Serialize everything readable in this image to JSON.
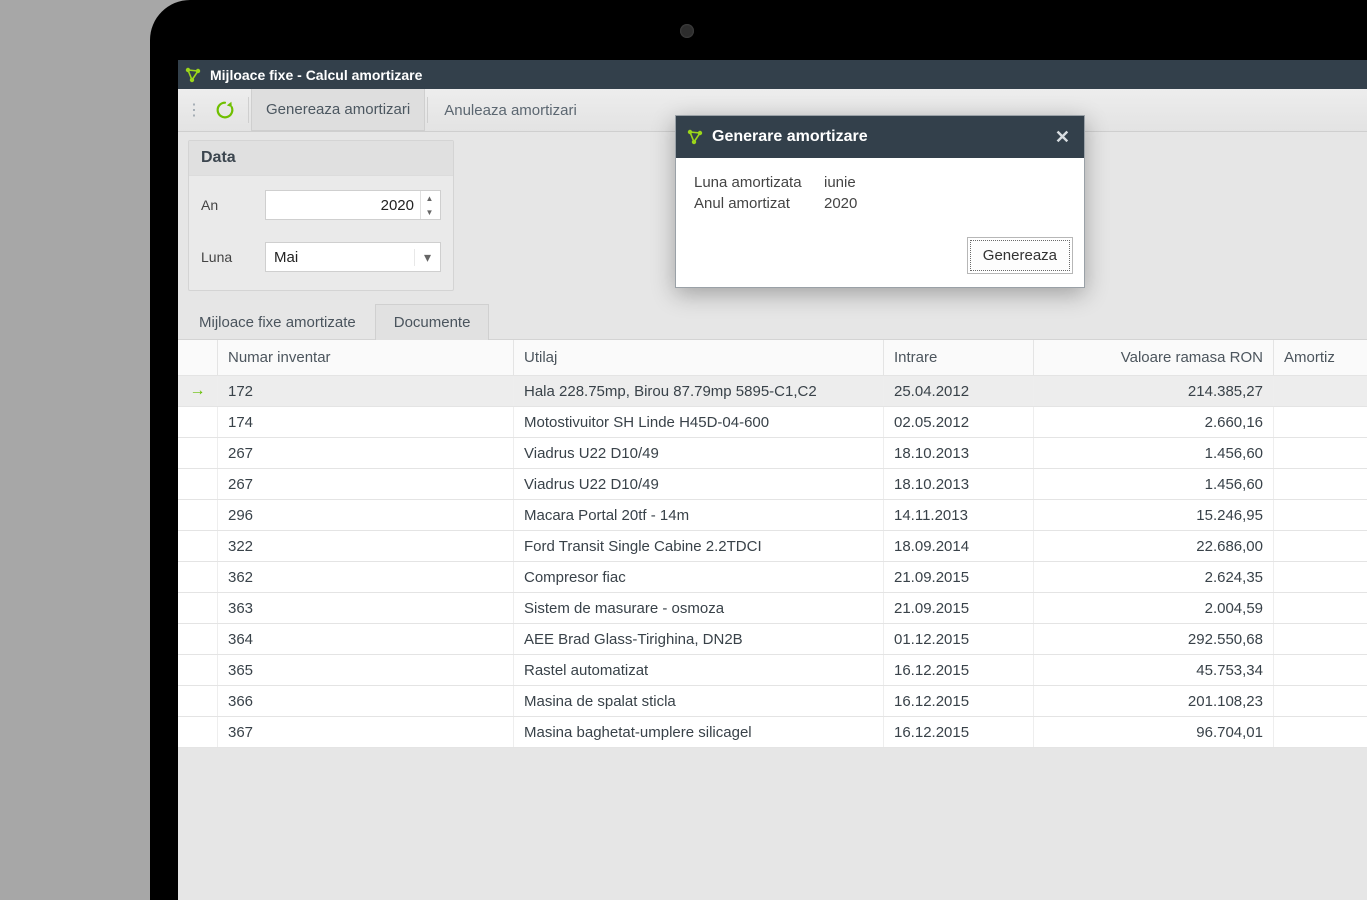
{
  "title": "Mijloace fixe - Calcul amortizare",
  "toolbar": {
    "generate": "Genereaza amortizari",
    "cancel": "Anuleaza amortizari"
  },
  "filter": {
    "panel_title": "Data",
    "year_label": "An",
    "year_value": "2020",
    "month_label": "Luna",
    "month_value": "Mai"
  },
  "subtabs": {
    "amortizate": "Mijloace fixe amortizate",
    "documente": "Documente"
  },
  "grid": {
    "headers": {
      "inv": "Numar inventar",
      "tool": "Utilaj",
      "date": "Intrare",
      "val": "Valoare ramasa RON",
      "am": "Amortiz"
    },
    "rows": [
      {
        "inv": "172",
        "tool": "Hala 228.75mp, Birou 87.79mp 5895-C1,C2",
        "date": "25.04.2012",
        "val": "214.385,27",
        "sel": true
      },
      {
        "inv": "174",
        "tool": "Motostivuitor SH Linde H45D-04-600",
        "date": "02.05.2012",
        "val": "2.660,16"
      },
      {
        "inv": "267",
        "tool": "Viadrus U22 D10/49",
        "date": "18.10.2013",
        "val": "1.456,60"
      },
      {
        "inv": "267",
        "tool": "Viadrus U22 D10/49",
        "date": "18.10.2013",
        "val": "1.456,60"
      },
      {
        "inv": "296",
        "tool": "Macara Portal 20tf - 14m",
        "date": "14.11.2013",
        "val": "15.246,95"
      },
      {
        "inv": "322",
        "tool": "Ford Transit Single Cabine 2.2TDCI",
        "date": "18.09.2014",
        "val": "22.686,00"
      },
      {
        "inv": "362",
        "tool": "Compresor fiac",
        "date": "21.09.2015",
        "val": "2.624,35"
      },
      {
        "inv": "363",
        "tool": "Sistem de masurare - osmoza",
        "date": "21.09.2015",
        "val": "2.004,59"
      },
      {
        "inv": "364",
        "tool": "AEE Brad Glass-Tirighina, DN2B",
        "date": "01.12.2015",
        "val": "292.550,68"
      },
      {
        "inv": "365",
        "tool": "Rastel automatizat",
        "date": "16.12.2015",
        "val": "45.753,34"
      },
      {
        "inv": "366",
        "tool": "Masina de spalat sticla",
        "date": "16.12.2015",
        "val": "201.108,23"
      },
      {
        "inv": "367",
        "tool": "Masina baghetat-umplere silicagel",
        "date": "16.12.2015",
        "val": "96.704,01"
      }
    ]
  },
  "modal": {
    "title": "Generare amortizare",
    "month_label": "Luna amortizata",
    "month_value": "iunie",
    "year_label": "Anul amortizat",
    "year_value": "2020",
    "button": "Genereaza"
  }
}
